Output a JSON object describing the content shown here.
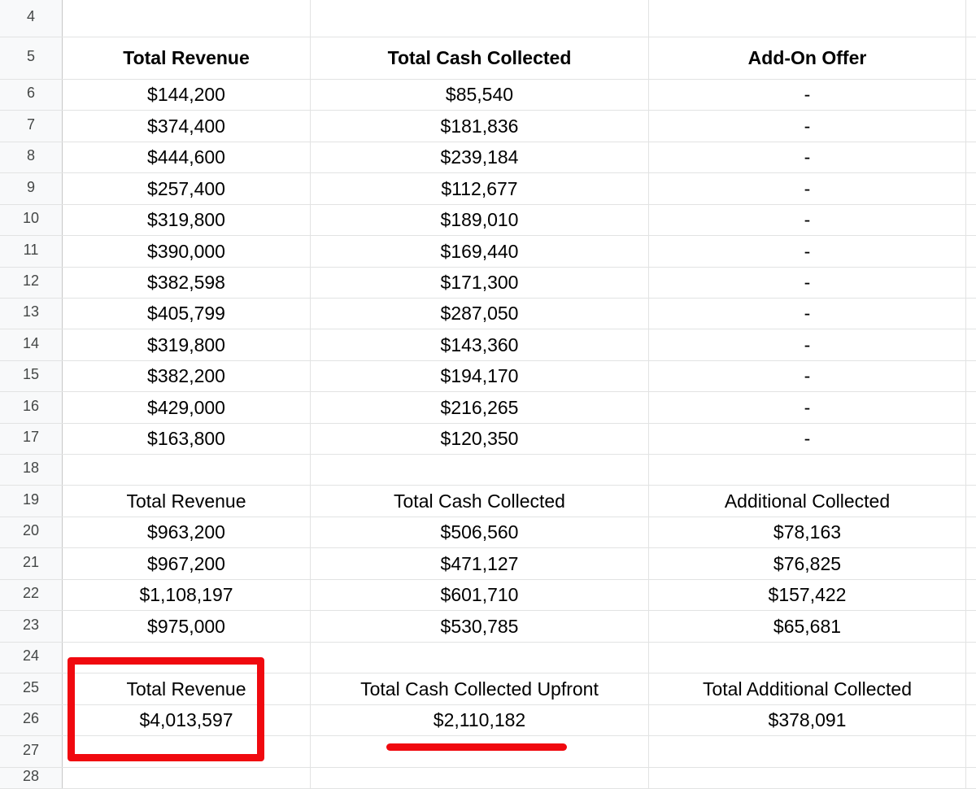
{
  "sheet": {
    "rows": [
      {
        "num": "4",
        "a": "",
        "b": "",
        "c": "",
        "bold": false
      },
      {
        "num": "5",
        "a": "Total Revenue",
        "b": "Total Cash Collected",
        "c": "Add-On Offer",
        "bold": true
      },
      {
        "num": "6",
        "a": "$144,200",
        "b": "$85,540",
        "c": "-",
        "bold": false
      },
      {
        "num": "7",
        "a": "$374,400",
        "b": "$181,836",
        "c": "-",
        "bold": false
      },
      {
        "num": "8",
        "a": "$444,600",
        "b": "$239,184",
        "c": "-",
        "bold": false
      },
      {
        "num": "9",
        "a": "$257,400",
        "b": "$112,677",
        "c": "-",
        "bold": false
      },
      {
        "num": "10",
        "a": "$319,800",
        "b": "$189,010",
        "c": "-",
        "bold": false
      },
      {
        "num": "11",
        "a": "$390,000",
        "b": "$169,440",
        "c": "-",
        "bold": false
      },
      {
        "num": "12",
        "a": "$382,598",
        "b": "$171,300",
        "c": "-",
        "bold": false
      },
      {
        "num": "13",
        "a": "$405,799",
        "b": "$287,050",
        "c": "-",
        "bold": false
      },
      {
        "num": "14",
        "a": "$319,800",
        "b": "$143,360",
        "c": "-",
        "bold": false
      },
      {
        "num": "15",
        "a": "$382,200",
        "b": "$194,170",
        "c": "-",
        "bold": false
      },
      {
        "num": "16",
        "a": "$429,000",
        "b": "$216,265",
        "c": "-",
        "bold": false
      },
      {
        "num": "17",
        "a": "$163,800",
        "b": "$120,350",
        "c": "-",
        "bold": false
      },
      {
        "num": "18",
        "a": "",
        "b": "",
        "c": "",
        "bold": false
      },
      {
        "num": "19",
        "a": "Total Revenue",
        "b": "Total Cash Collected",
        "c": "Additional Collected",
        "bold": false
      },
      {
        "num": "20",
        "a": "$963,200",
        "b": "$506,560",
        "c": "$78,163",
        "bold": false
      },
      {
        "num": "21",
        "a": "$967,200",
        "b": "$471,127",
        "c": "$76,825",
        "bold": false
      },
      {
        "num": "22",
        "a": "$1,108,197",
        "b": "$601,710",
        "c": "$157,422",
        "bold": false
      },
      {
        "num": "23",
        "a": "$975,000",
        "b": "$530,785",
        "c": "$65,681",
        "bold": false
      },
      {
        "num": "24",
        "a": "",
        "b": "",
        "c": "",
        "bold": false
      },
      {
        "num": "25",
        "a": "Total Revenue",
        "b": "Total Cash Collected Upfront",
        "c": "Total Additional Collected",
        "bold": false
      },
      {
        "num": "26",
        "a": "$4,013,597",
        "b": "$2,110,182",
        "c": "$378,091",
        "bold": false
      },
      {
        "num": "27",
        "a": "",
        "b": "",
        "c": "",
        "bold": false
      },
      {
        "num": "28",
        "a": "",
        "b": "",
        "c": "",
        "bold": false
      }
    ]
  },
  "annotations": {
    "box_color": "#f0090f",
    "underline_color": "#f0090f"
  }
}
